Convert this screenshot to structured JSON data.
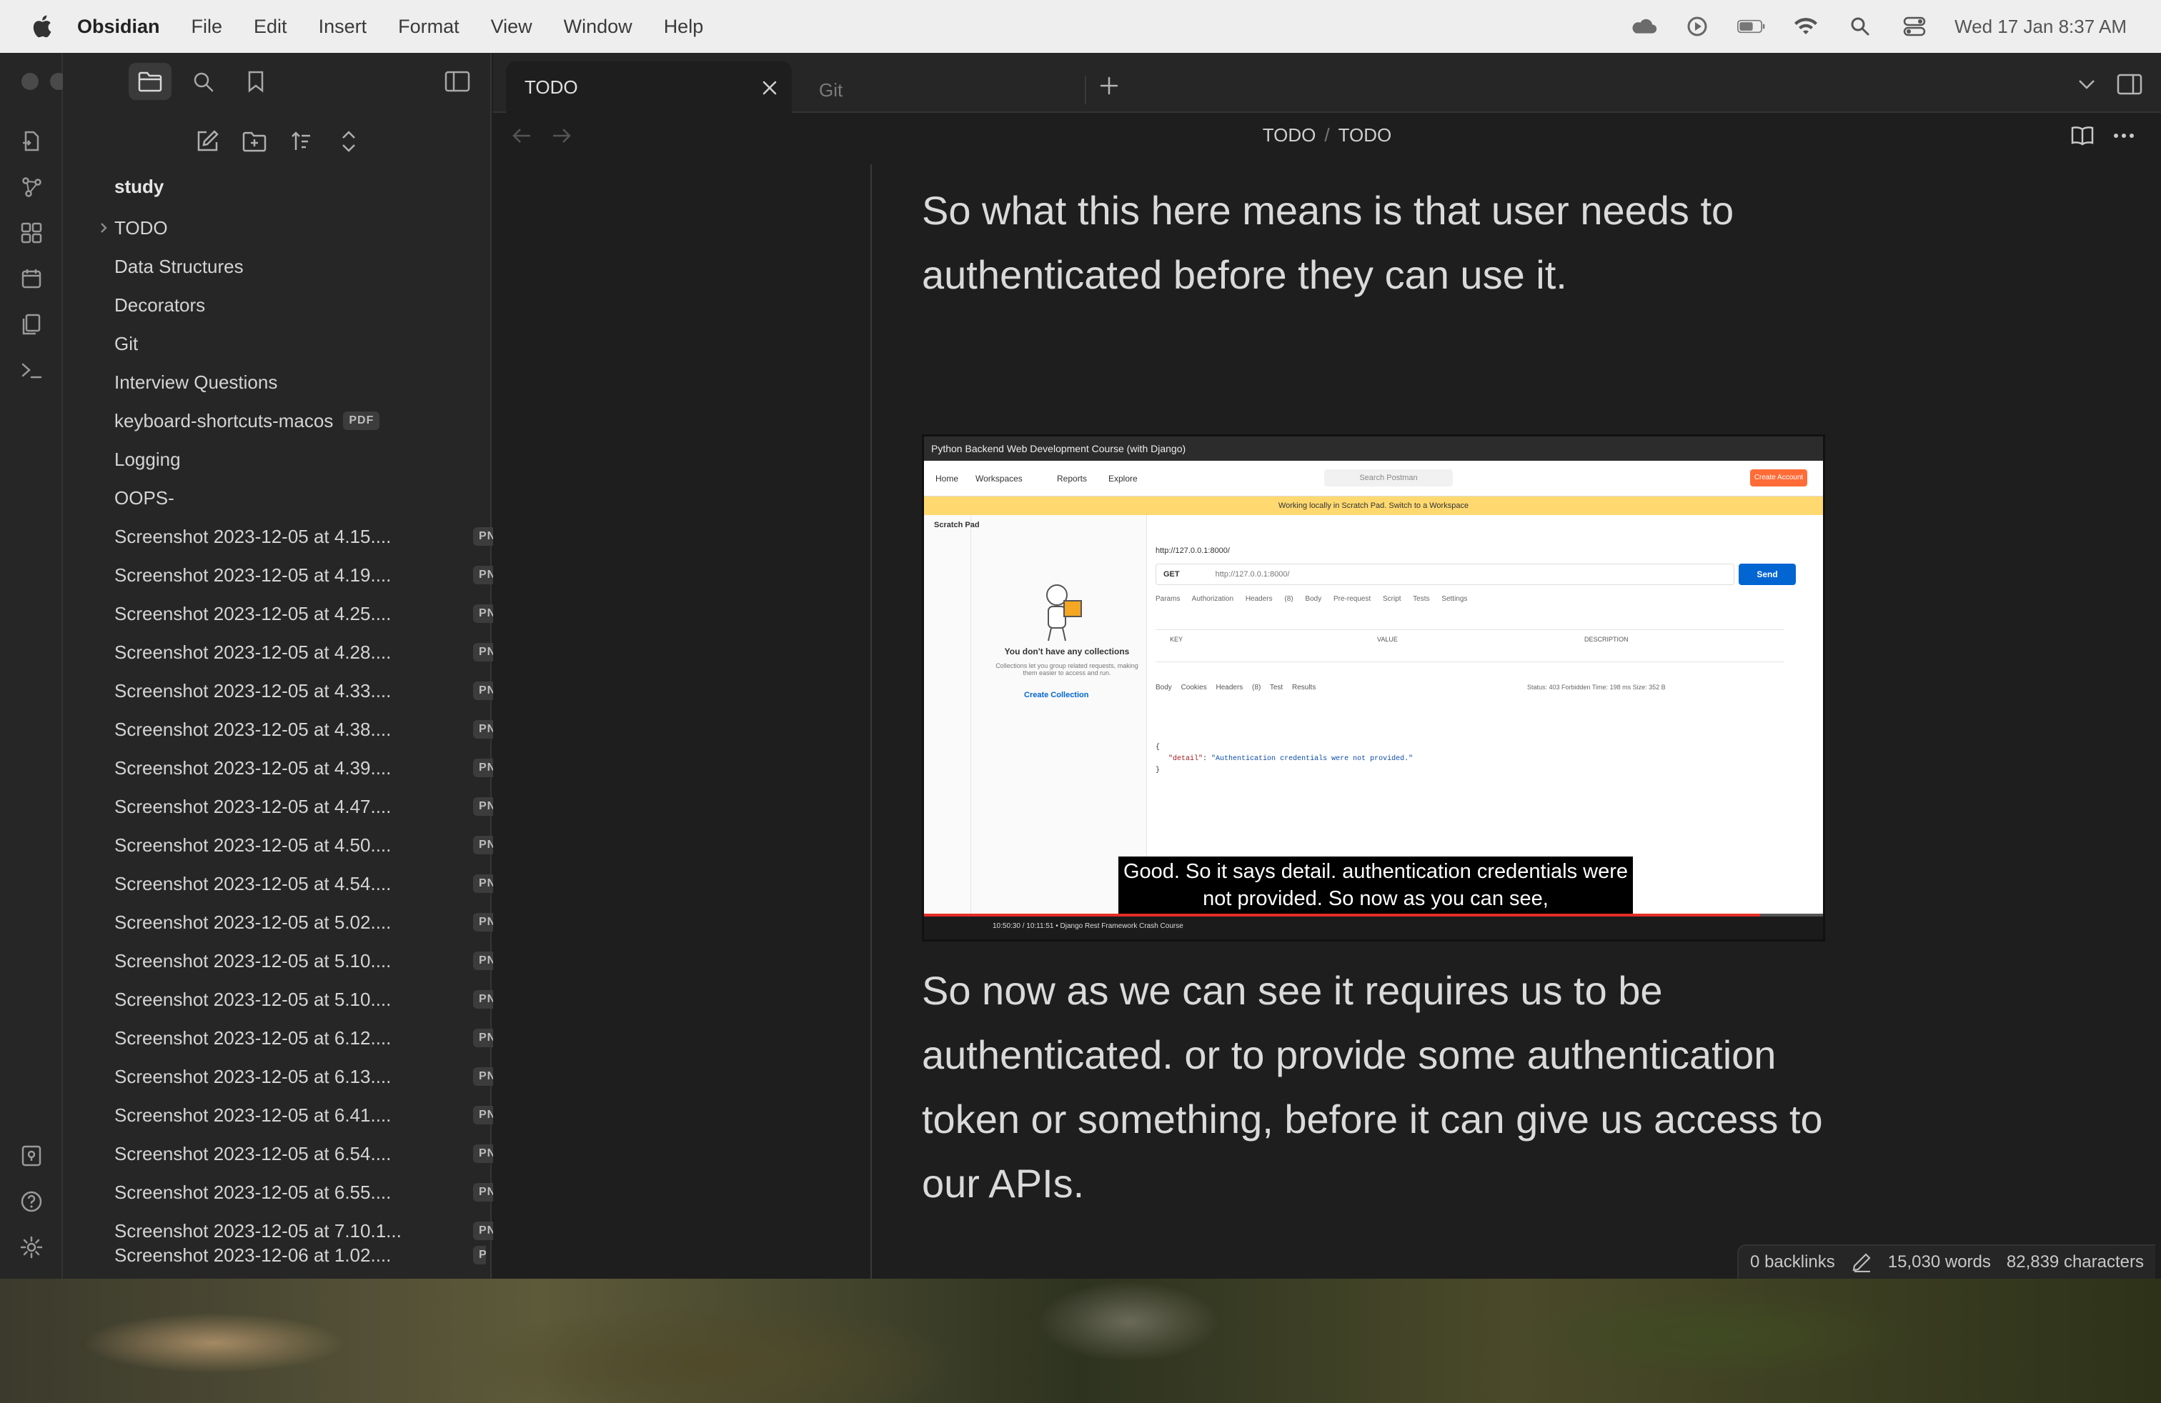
{
  "menubar": {
    "app_name": "Obsidian",
    "items": [
      "File",
      "Edit",
      "Insert",
      "Format",
      "View",
      "Window",
      "Help"
    ],
    "clock": "Wed 17 Jan  8:37 AM"
  },
  "sidebar": {
    "vault_root": "study",
    "items": [
      {
        "label": "TODO",
        "badge": ""
      },
      {
        "label": "Data Structures",
        "badge": ""
      },
      {
        "label": "Decorators",
        "badge": ""
      },
      {
        "label": "Git",
        "badge": ""
      },
      {
        "label": "Interview Questions",
        "badge": ""
      },
      {
        "label": "keyboard-shortcuts-macos",
        "badge": "PDF"
      },
      {
        "label": "Logging",
        "badge": ""
      },
      {
        "label": "OOPS-",
        "badge": ""
      },
      {
        "label": "Screenshot 2023-12-05 at 4.15....",
        "badge": "PNG"
      },
      {
        "label": "Screenshot 2023-12-05 at 4.19....",
        "badge": "PNG"
      },
      {
        "label": "Screenshot 2023-12-05 at 4.25....",
        "badge": "PNG"
      },
      {
        "label": "Screenshot 2023-12-05 at 4.28....",
        "badge": "PNG"
      },
      {
        "label": "Screenshot 2023-12-05 at 4.33....",
        "badge": "PNG"
      },
      {
        "label": "Screenshot 2023-12-05 at 4.38....",
        "badge": "PNG"
      },
      {
        "label": "Screenshot 2023-12-05 at 4.39....",
        "badge": "PNG"
      },
      {
        "label": "Screenshot 2023-12-05 at 4.47....",
        "badge": "PNG"
      },
      {
        "label": "Screenshot 2023-12-05 at 4.50....",
        "badge": "PNG"
      },
      {
        "label": "Screenshot 2023-12-05 at 4.54....",
        "badge": "PNG"
      },
      {
        "label": "Screenshot 2023-12-05 at 5.02....",
        "badge": "PNG"
      },
      {
        "label": "Screenshot 2023-12-05 at 5.10....",
        "badge": "PNG"
      },
      {
        "label": "Screenshot 2023-12-05 at 5.10....",
        "badge": "PNG"
      },
      {
        "label": "Screenshot 2023-12-05 at 6.12....",
        "badge": "PNG"
      },
      {
        "label": "Screenshot 2023-12-05 at 6.13....",
        "badge": "PNG"
      },
      {
        "label": "Screenshot 2023-12-05 at 6.41....",
        "badge": "PNG"
      },
      {
        "label": "Screenshot 2023-12-05 at 6.54....",
        "badge": "PNG"
      },
      {
        "label": "Screenshot 2023-12-05 at 6.55....",
        "badge": "PNG"
      },
      {
        "label": "Screenshot 2023-12-05 at 7.10.1...",
        "badge": "PNG"
      },
      {
        "label": "Screenshot 2023-12-06 at 1.02....",
        "badge": "PNG"
      }
    ]
  },
  "tabs": {
    "active": "TODO",
    "inactive": "Git"
  },
  "breadcrumb": {
    "parent": "TODO",
    "separator": "/",
    "current": "TODO"
  },
  "editor": {
    "para1": "So what this here means is that user needs to authenticated before they can use it.",
    "para2": "So now as we can see it requires us to be authenticated. or to provide some authentication token or something, before it can give us access to our APIs."
  },
  "embed": {
    "window_title": "Python Backend Web Development Course (with Django)",
    "nav": [
      "Home",
      "Workspaces",
      "Reports",
      "Explore"
    ],
    "search": "Search Postman",
    "create_account": "Create Account",
    "banner": "Working locally in Scratch Pad. Switch to a Workspace",
    "scratch_pad": "Scratch Pad",
    "empty_title": "You don't have any collections",
    "empty_sub": "Collections let you group related requests, making them easier to access and run.",
    "create_collection": "Create Collection",
    "url": "http://127.0.0.1:8000/",
    "method": "GET",
    "send": "Send",
    "req_tabs": "Params Authorization Headers (8) Body Pre-request Script Tests Settings",
    "table_key": "KEY",
    "table_value": "VALUE",
    "table_desc": "DESCRIPTION",
    "resp_tabs": "Body Cookies Headers (8) Test Results",
    "status": "Status: 403 Forbidden  Time: 198 ms  Size: 352 B",
    "code_line1": "{",
    "code_key": "\"detail\"",
    "code_val": "\"Authentication credentials were not provided.\"",
    "code_line3": "}",
    "caption": "Good. So it says detail. authentication credentials were not provided. So now as you can see,",
    "player_text": "10:50:30 / 10:11:51 • Django Rest Framework Crash Course",
    "progress": 0.93
  },
  "statusbar": {
    "backlinks": "0 backlinks",
    "words": "15,030 words",
    "characters": "82,839 characters"
  },
  "colors": {
    "accent": "#7f6df2",
    "postman_orange": "#ff6c37",
    "postman_blue": "#0265d2"
  }
}
